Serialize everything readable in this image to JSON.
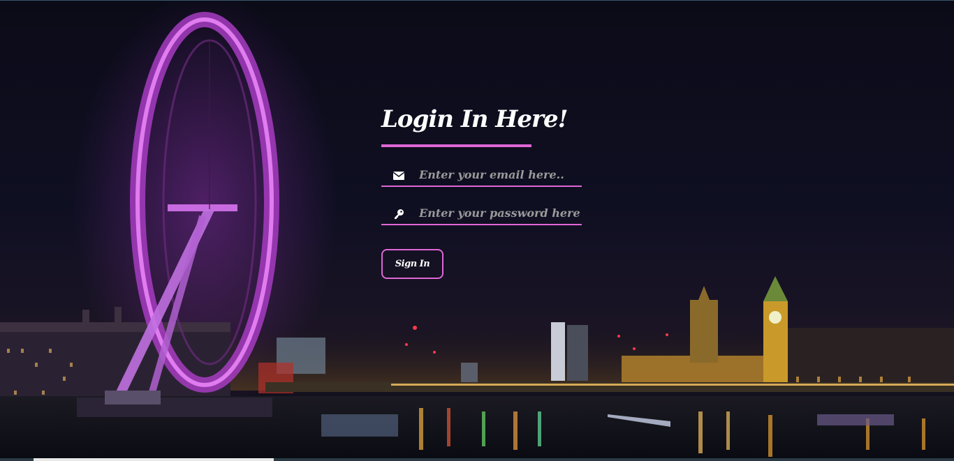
{
  "login": {
    "title": "Login In Here!",
    "email_placeholder": "Enter your email here..",
    "password_placeholder": "Enter your password here",
    "signin_label": "Sign In"
  },
  "icons": {
    "email": "envelope-icon",
    "password": "key-icon"
  },
  "colors": {
    "accent": "#e066d6",
    "text": "#ffffff",
    "placeholder": "#9a9a9a",
    "sky": "#0d0d1c"
  },
  "background": {
    "scene": "london-eye-night-skyline"
  }
}
